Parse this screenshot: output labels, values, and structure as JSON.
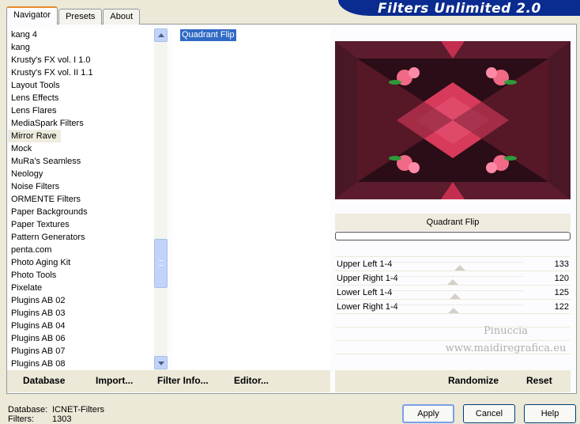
{
  "tabs": [
    "Navigator",
    "Presets",
    "About"
  ],
  "banner_title": "Filters Unlimited 2.0",
  "categories": [
    "kang 4",
    "kang",
    "Krusty's FX vol. I 1.0",
    "Krusty's FX vol. II 1.1",
    "Layout Tools",
    "Lens Effects",
    "Lens Flares",
    "MediaSpark Filters",
    "Mirror Rave",
    "Mock",
    "MuRa's Seamless",
    "Neology",
    "Noise Filters",
    "ORMENTE Filters",
    "Paper Backgrounds",
    "Paper Textures",
    "Pattern Generators",
    "penta.com",
    "Photo Aging Kit",
    "Photo Tools",
    "Pixelate",
    "Plugins AB 02",
    "Plugins AB 03",
    "Plugins AB 04",
    "Plugins AB 06",
    "Plugins AB 07",
    "Plugins AB 08"
  ],
  "selected_category": "Mirror Rave",
  "filters": [
    "Quadrant Flip"
  ],
  "filter_name": "Quadrant Flip",
  "sliders": [
    {
      "label": "Upper Left 1-4",
      "value": 133
    },
    {
      "label": "Upper Right 1-4",
      "value": 120
    },
    {
      "label": "Lower Left 1-4",
      "value": 125
    },
    {
      "label": "Lower Right 1-4",
      "value": 122
    }
  ],
  "slider_max": 255,
  "watermark": [
    "Pinuccia",
    "www.maidiregrafica.eu"
  ],
  "left_buttons": {
    "database": "Database",
    "import": "Import...",
    "filter_info": "Filter Info...",
    "editor": "Editor..."
  },
  "right_buttons": {
    "randomize": "Randomize",
    "reset": "Reset"
  },
  "status": {
    "database_label": "Database:",
    "database_value": "ICNET-Filters",
    "filters_label": "Filters:",
    "filters_value": "1303"
  },
  "dialog_buttons": {
    "apply": "Apply",
    "cancel": "Cancel",
    "help": "Help"
  },
  "colors": {
    "accent": "#316ac5",
    "preview_dark": "#3a1320",
    "preview_pink": "#d73a5a",
    "banner": "#0a2b8f"
  }
}
